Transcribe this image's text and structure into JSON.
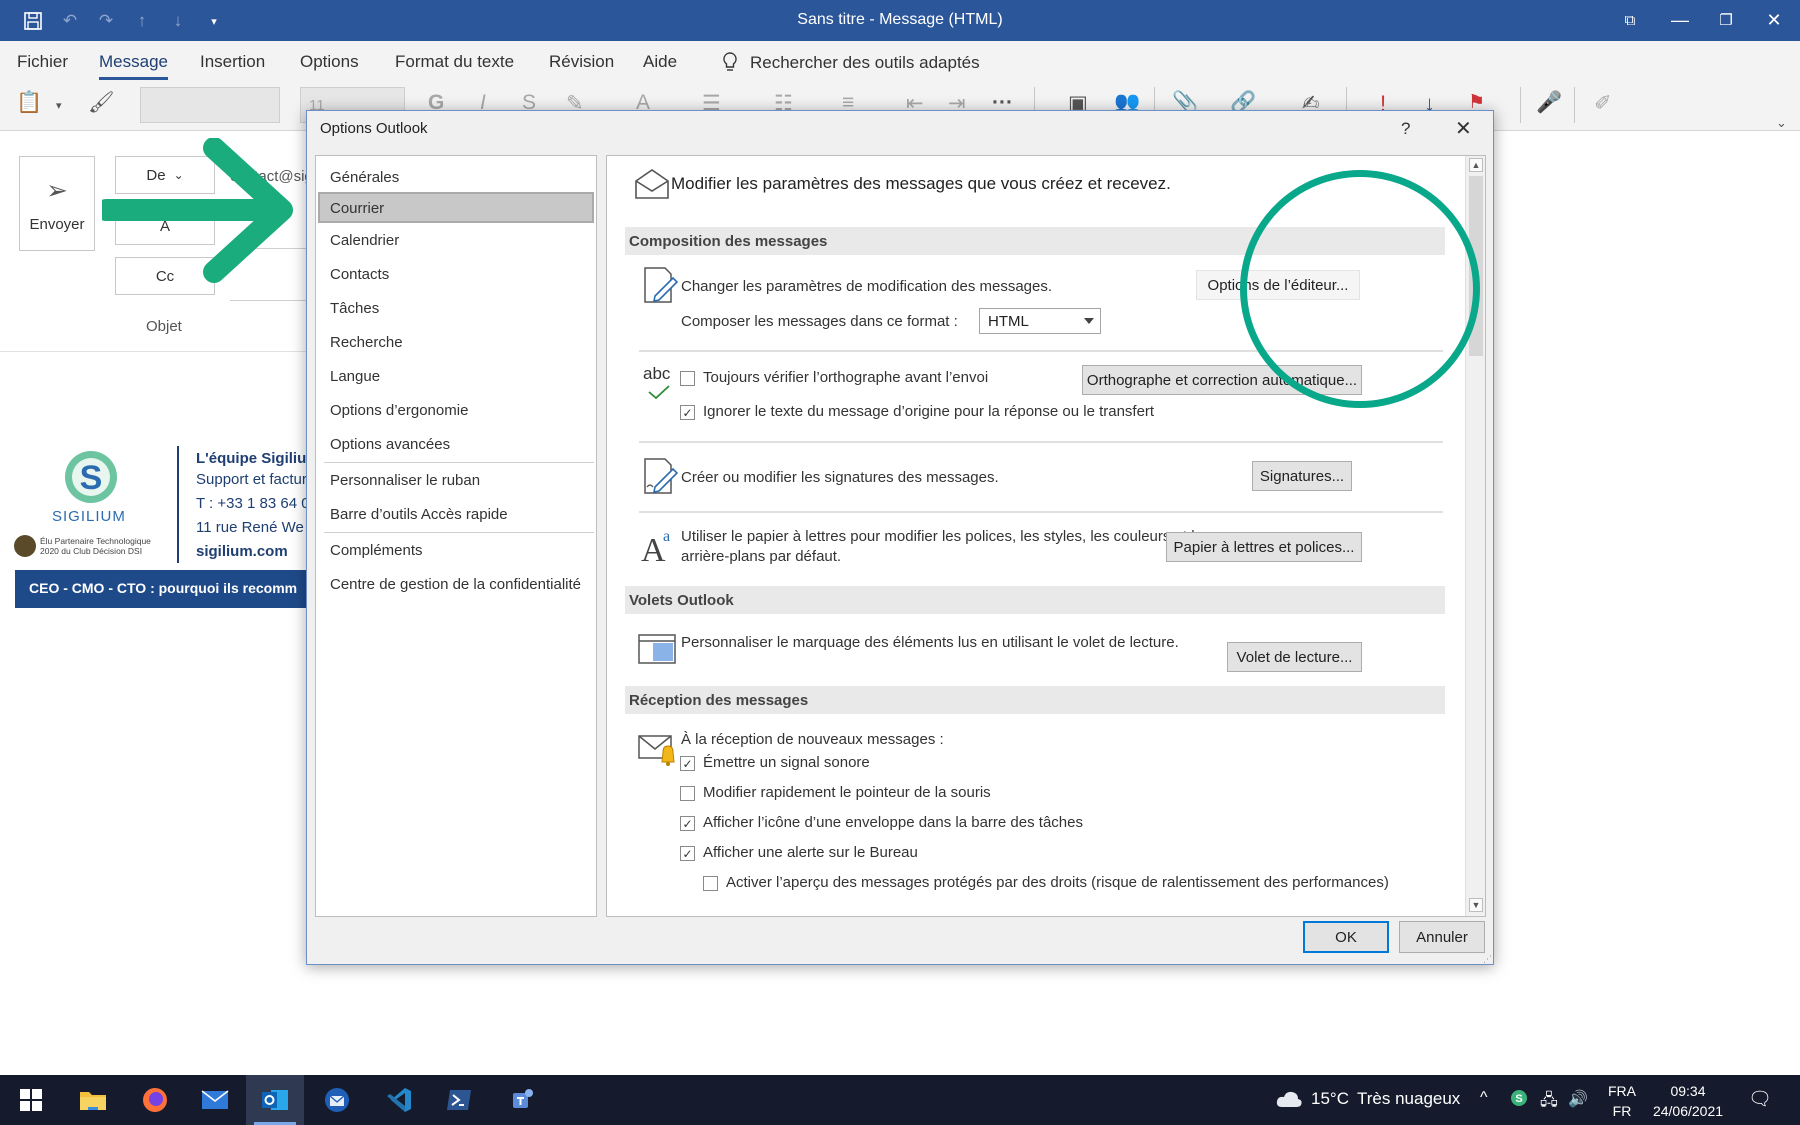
{
  "window": {
    "title": "Sans titre  -  Message (HTML)"
  },
  "menu": {
    "items": [
      "Fichier",
      "Message",
      "Insertion",
      "Options",
      "Format du texte",
      "Révision",
      "Aide"
    ],
    "search": "Rechercher des outils adaptés"
  },
  "ribbon": {
    "font_size": "11"
  },
  "compose": {
    "send_label": "Envoyer",
    "from_label": "De",
    "to_label": "A",
    "cc_label": "Cc",
    "from_value": "contact@sig",
    "subject_label": "Objet"
  },
  "signature": {
    "brand": "SIGILIUM",
    "award_line1": "Élu Partenaire Technologique",
    "award_line2": "2020 du Club Décision DSI",
    "name": "L'équipe Sigiliu",
    "role": "Support et factur",
    "phone": "T : +33 1 83 64 0",
    "address": "11 rue René We",
    "website": "sigilium.com",
    "banner": "CEO - CMO - CTO : pourquoi ils recomm"
  },
  "dialog": {
    "title": "Options Outlook",
    "help": "?",
    "close": "✕",
    "nav": [
      "Générales",
      "Courrier",
      "Calendrier",
      "Contacts",
      "Tâches",
      "Recherche",
      "Langue",
      "Options d’ergonomie",
      "Options avancées",
      "Personnaliser le ruban",
      "Barre d’outils Accès rapide",
      "Compléments",
      "Centre de gestion de la confidentialité"
    ],
    "header": "Modifier les paramètres des messages que vous créez et recevez.",
    "sections": {
      "composition": "Composition des messages",
      "volets": "Volets Outlook",
      "reception": "Réception des messages"
    },
    "composition": {
      "edit_text": "Changer les paramètres de modification des messages.",
      "editor_button": "Options de l’éditeur...",
      "format_label": "Composer les messages dans ce format :",
      "format_value": "HTML",
      "spell_icon_text": "abc",
      "spell_check": "Toujours vérifier l’orthographe avant l’envoi",
      "spell_button": "Orthographe et correction automatique...",
      "ignore_original": "Ignorer le texte du message d’origine pour la réponse ou le transfert",
      "signature_text": "Créer ou modifier les signatures des messages.",
      "signature_button": "Signatures...",
      "stationery_text": "Utiliser le papier à lettres pour modifier les polices, les styles, les couleurs et les arrière-plans par défaut.",
      "stationery_button": "Papier à lettres et polices..."
    },
    "volets": {
      "text": "Personnaliser le marquage des éléments lus en utilisant le volet de lecture.",
      "button": "Volet de lecture..."
    },
    "reception": {
      "intro": "À la réception de nouveaux messages :",
      "options": [
        {
          "label": "Émettre un signal sonore",
          "checked": true
        },
        {
          "label": "Modifier rapidement le pointeur de la souris",
          "checked": false
        },
        {
          "label": "Afficher l’icône d’une enveloppe dans la barre des tâches",
          "checked": true
        },
        {
          "label": "Afficher une alerte sur le Bureau",
          "checked": true
        },
        {
          "label": "Activer l’aperçu des messages protégés par des droits (risque de ralentissement des performances)",
          "checked": false
        }
      ]
    },
    "ok": "OK",
    "cancel": "Annuler"
  },
  "taskbar": {
    "weather_temp": "15°C",
    "weather_desc": "Très nuageux",
    "lang_line1": "FRA",
    "lang_line2": "FR",
    "time": "09:34",
    "date": "24/06/2021"
  },
  "colors": {
    "title_bar": "#2b579a",
    "annotation": "#0aa88a",
    "taskbar": "#151b2c"
  }
}
